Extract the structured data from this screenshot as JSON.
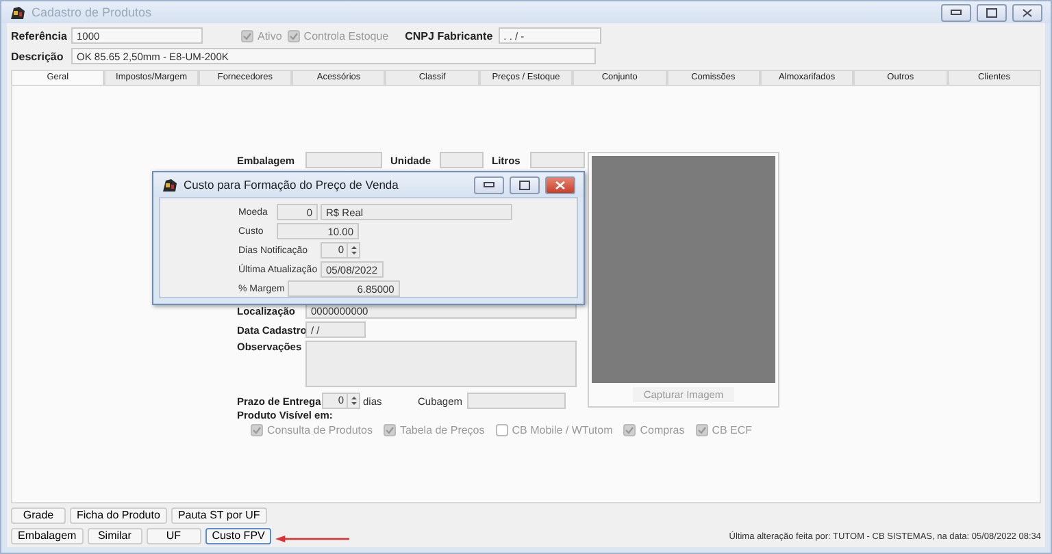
{
  "window": {
    "title": "Cadastro de Produtos"
  },
  "header": {
    "referencia": {
      "label": "Referência",
      "value": "1000"
    },
    "checks": [
      {
        "label": "Ativo",
        "checked": true
      },
      {
        "label": "Controla Estoque",
        "checked": true
      }
    ],
    "cnpj": {
      "label": "CNPJ Fabricante",
      "value": " .  .  /  -"
    },
    "descricao": {
      "label": "Descrição",
      "value": "OK 85.65 2,50mm - E8-UM-200K"
    }
  },
  "tabs": [
    {
      "label": "Geral",
      "selected": true
    },
    {
      "label": "Impostos/Margem",
      "selected": false
    },
    {
      "label": "Fornecedores",
      "selected": false
    },
    {
      "label": "Acessórios",
      "selected": false
    },
    {
      "label": "Classif",
      "selected": false
    },
    {
      "label": "Preços / Estoque",
      "selected": false
    },
    {
      "label": "Conjunto",
      "selected": false
    },
    {
      "label": "Comissões",
      "selected": false
    },
    {
      "label": "Almoxarifados",
      "selected": false
    },
    {
      "label": "Outros",
      "selected": false
    },
    {
      "label": "Clientes",
      "selected": false
    }
  ],
  "form": {
    "top_labels": [
      "Embalagem",
      "Unidade",
      "Litros"
    ],
    "localizacao": {
      "label": "Localização",
      "value": "0000000000"
    },
    "data_cadastro": {
      "label": "Data Cadastro",
      "value": " / /"
    },
    "observacoes": {
      "label": "Observações"
    },
    "prazo": {
      "label": "Prazo de Entrega",
      "value": "0",
      "unit": "dias"
    },
    "cubagem": {
      "label": "Cubagem"
    },
    "visible_in": {
      "label": "Produto Visível em:",
      "options": [
        {
          "label": "Consulta de Produtos",
          "checked": true
        },
        {
          "label": "Tabela de Preços",
          "checked": true
        },
        {
          "label": "CB Mobile / WTutom",
          "checked": false
        },
        {
          "label": "Compras",
          "checked": true
        },
        {
          "label": "CB ECF",
          "checked": true
        }
      ]
    },
    "image_button": "Capturar Imagem"
  },
  "dialog": {
    "title": "Custo para Formação do Preço de Venda",
    "rows": [
      {
        "kind": "pair",
        "label": "Moeda",
        "code": "0",
        "value": "R$ Real"
      },
      {
        "kind": "number",
        "label": "Custo",
        "value": "10.00"
      },
      {
        "kind": "spin",
        "label": "Dias Notificação",
        "value": "0"
      },
      {
        "kind": "date",
        "label": "Última Atualização",
        "value": "05/08/2022"
      },
      {
        "kind": "number",
        "label": "% Margem",
        "value": "6.85000"
      }
    ]
  },
  "buttons": [
    [
      {
        "label": "Grade",
        "selected": false
      },
      {
        "label": "Ficha do Produto",
        "selected": false
      },
      {
        "label": "Pauta ST por UF",
        "selected": false
      }
    ],
    [
      {
        "label": "Embalagem",
        "selected": false
      },
      {
        "label": "Similar",
        "selected": false
      },
      {
        "label": "UF",
        "selected": false
      },
      {
        "label": "Custo FPV",
        "selected": true
      }
    ]
  ],
  "status": "Última alteração feita por: TUTOM - CB SISTEMAS, na data: 05/08/2022 08:34"
}
